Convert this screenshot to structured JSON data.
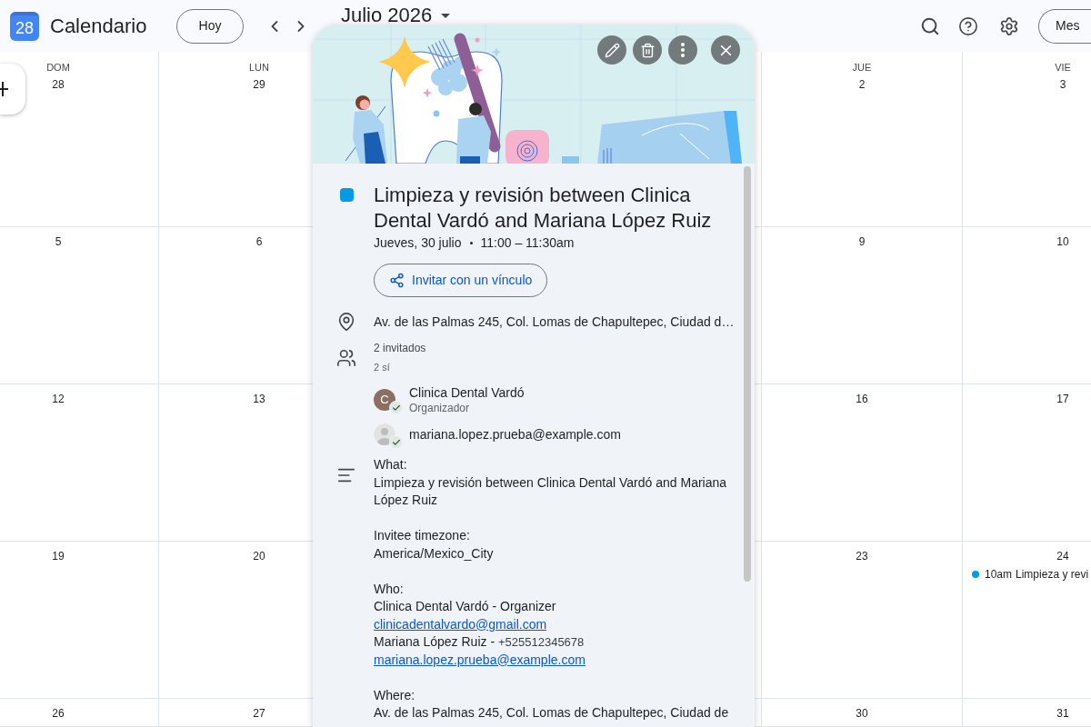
{
  "header": {
    "logo_day": "28",
    "app_name": "Calendario",
    "today_button": "Hoy",
    "period": "Julio 2026",
    "view_button": "Mes"
  },
  "calendar": {
    "day_names": [
      "DOM",
      "LUN",
      "JUE",
      "VIE"
    ],
    "weeks": [
      {
        "days": [
          {
            "date": "28"
          },
          {
            "date": "29"
          },
          {
            "date": "2"
          },
          {
            "date": "3"
          }
        ]
      },
      {
        "days": [
          {
            "date": "5"
          },
          {
            "date": "6"
          },
          {
            "date": "9"
          },
          {
            "date": "10"
          }
        ]
      },
      {
        "days": [
          {
            "date": "12"
          },
          {
            "date": "13"
          },
          {
            "date": "16"
          },
          {
            "date": "17"
          }
        ]
      },
      {
        "days": [
          {
            "date": "19"
          },
          {
            "date": "20"
          },
          {
            "date": "23"
          },
          {
            "date": "24",
            "events": [
              {
                "time": "10am",
                "title": "Limpieza y revi"
              }
            ]
          }
        ]
      },
      {
        "days": [
          {
            "date": "26"
          },
          {
            "date": "27"
          },
          {
            "date": "30"
          },
          {
            "date": "31"
          }
        ]
      }
    ]
  },
  "event": {
    "title": "Limpieza y revisión between Clinica Dental Vardó and Mariana López Ruiz",
    "date": "Jueves, 30 julio",
    "time": "11:00 – 11:30am",
    "invite_button": "Invitar con un vínculo",
    "location": "Av. de las Palmas 245, Col. Lomas de Chapultepec, Ciudad d…",
    "guests_summary": "2 invitados",
    "guests_replies": "2 sí",
    "guests": [
      {
        "initial": "C",
        "name": "Clinica Dental Vardó",
        "role": "Organizador",
        "accepted": true
      },
      {
        "name": "mariana.lopez.prueba@example.com",
        "accepted": true
      }
    ],
    "description": [
      {
        "heading": "What:",
        "lines": [
          {
            "kind": "text",
            "text": "Limpieza y revisión between Clinica Dental Vardó and Mariana López Ruiz"
          }
        ]
      },
      {
        "heading": "Invitee timezone:",
        "lines": [
          {
            "kind": "text",
            "text": "America/Mexico_City"
          }
        ]
      },
      {
        "heading": "Who:",
        "lines": [
          {
            "kind": "text",
            "text": "Clinica Dental Vardó - Organizer"
          },
          {
            "kind": "link",
            "text": "clinicadentalvardo@gmail.com"
          },
          {
            "kind": "contact",
            "text": "Mariana López Ruiz -",
            "phone": "+525512345678"
          },
          {
            "kind": "link",
            "text": "mariana.lopez.prueba@example.com"
          }
        ]
      },
      {
        "heading": "Where:",
        "lines": [
          {
            "kind": "text",
            "text": "Av. de las Palmas 245, Col. Lomas de Chapultepec, Ciudad de"
          }
        ]
      }
    ]
  }
}
